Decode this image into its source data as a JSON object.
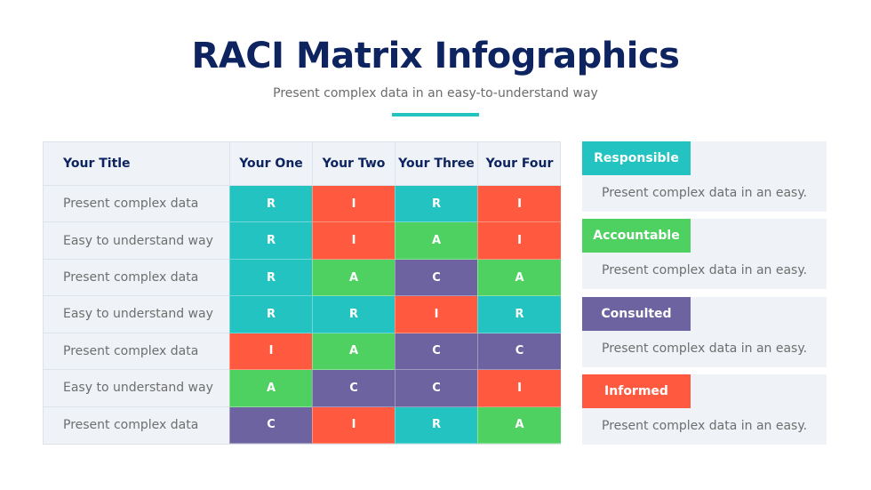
{
  "header": {
    "title": "RACI Matrix Infographics",
    "subtitle": "Present complex data in an easy-to-understand way",
    "accent_color": "#22c3c0"
  },
  "colors": {
    "R": "#22c3c0",
    "A": "#4fd162",
    "C": "#6c63a0",
    "I": "#ff5a40",
    "title": "#0e2460",
    "panel_bg": "#eff3f7"
  },
  "matrix": {
    "columns": [
      "Your Title",
      "Your One",
      "Your Two",
      "Your Three",
      "Your Four"
    ],
    "rows": [
      {
        "label": "Present complex data",
        "values": [
          "R",
          "I",
          "R",
          "I"
        ]
      },
      {
        "label": "Easy to understand way",
        "values": [
          "R",
          "I",
          "A",
          "I"
        ]
      },
      {
        "label": "Present complex data",
        "values": [
          "R",
          "A",
          "C",
          "A"
        ]
      },
      {
        "label": "Easy to understand way",
        "values": [
          "R",
          "R",
          "I",
          "R"
        ]
      },
      {
        "label": "Present complex data",
        "values": [
          "I",
          "A",
          "C",
          "C"
        ]
      },
      {
        "label": "Easy to understand way",
        "values": [
          "A",
          "C",
          "C",
          "I"
        ]
      },
      {
        "label": "Present complex data",
        "values": [
          "C",
          "I",
          "R",
          "A"
        ]
      }
    ]
  },
  "legend": [
    {
      "key": "R",
      "label": "Responsible",
      "text": "Present complex data in an easy."
    },
    {
      "key": "A",
      "label": "Accountable",
      "text": "Present complex data in an easy."
    },
    {
      "key": "C",
      "label": "Consulted",
      "text": "Present complex data in an easy."
    },
    {
      "key": "I",
      "label": "Informed",
      "text": "Present complex data in an easy."
    }
  ]
}
